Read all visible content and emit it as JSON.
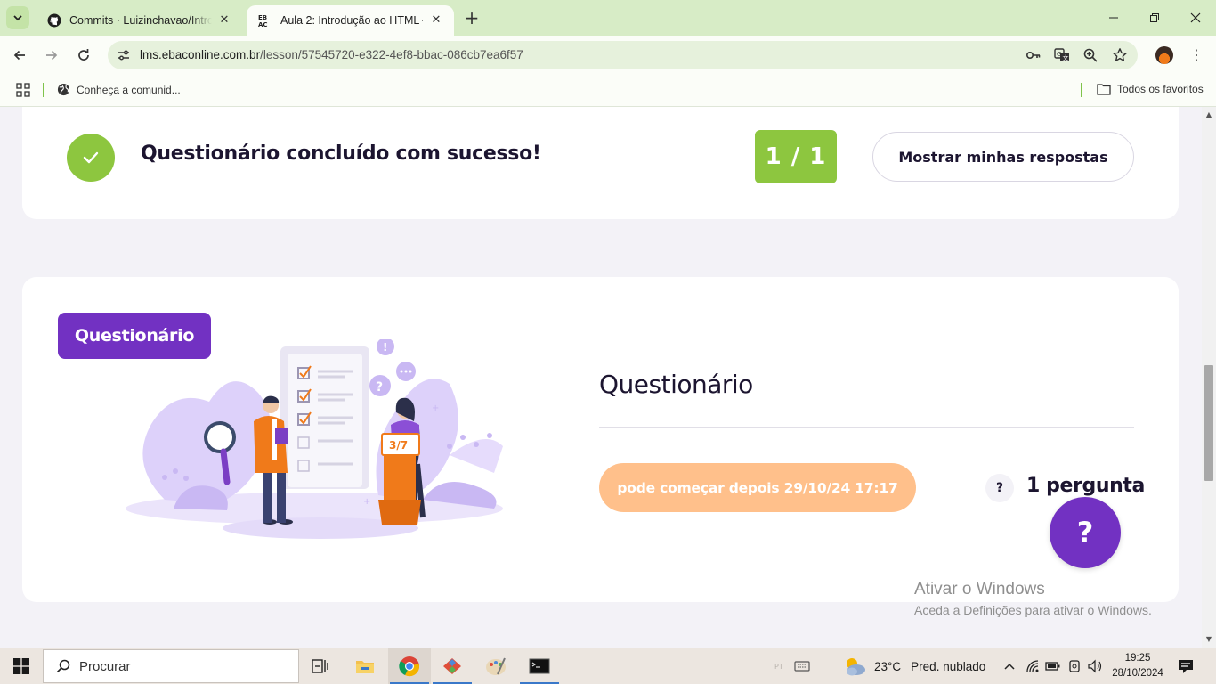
{
  "browser": {
    "tabs": [
      {
        "title": "Commits · Luizinchavao/Introdu",
        "icon": "github-icon",
        "active": false
      },
      {
        "title": "Aula 2: Introdução ao HTML —",
        "icon": "ebac-icon",
        "active": true
      }
    ],
    "new_tab_icon": "plus-icon",
    "url": {
      "host": "lms.ebaconline.com.br",
      "path": "/lesson/57545720-e322-4ef8-bbac-086cb7ea6f57"
    },
    "bookmarks": {
      "item": "Conheça a comunid...",
      "all_favorites": "Todos os favoritos"
    }
  },
  "result": {
    "message": "Questionário concluído com sucesso!",
    "score": "1 / 1",
    "show_answers_label": "Mostrar minhas respostas",
    "success_color": "#8dc63f"
  },
  "quiz": {
    "badge": "Questionário",
    "title": "Questionário",
    "start_label": "pode começar depois 29/10/24 17:17",
    "question_help": "?",
    "question_count": "1 pergunta",
    "illustration_podium": "3/7",
    "accent_color": "#7231c2",
    "start_color": "#ffc08b"
  },
  "help_fab": "?",
  "watermark": {
    "title": "Ativar o Windows",
    "subtitle": "Aceda a Definições para ativar o Windows."
  },
  "taskbar": {
    "search_placeholder": "Procurar",
    "weather": {
      "temp": "23°C",
      "condition": "Pred. nublado"
    },
    "time": "19:25",
    "date": "28/10/2024"
  }
}
